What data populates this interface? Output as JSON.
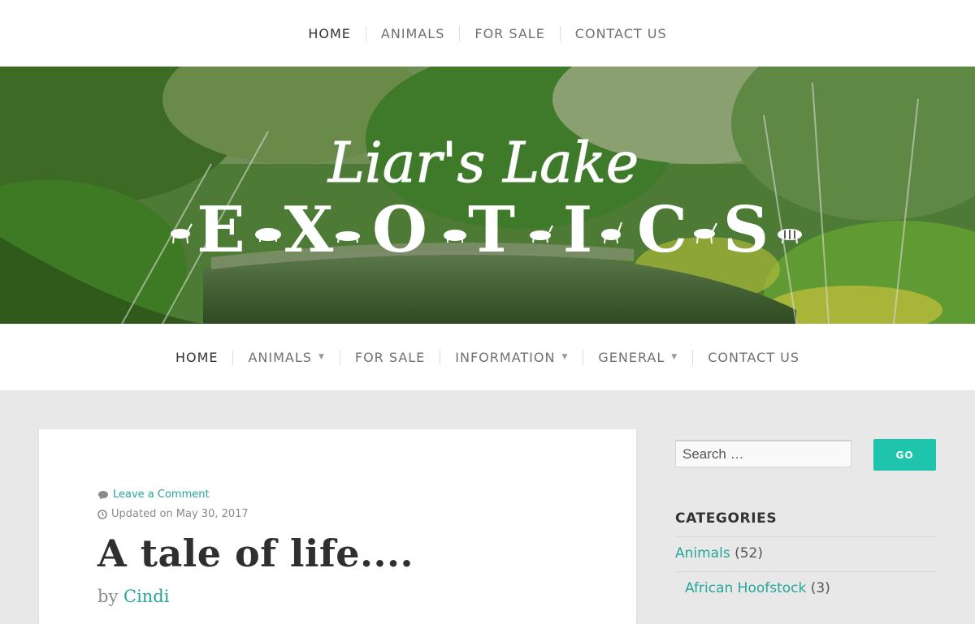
{
  "top_nav": {
    "items": [
      {
        "label": "HOME",
        "active": true
      },
      {
        "label": "ANIMALS"
      },
      {
        "label": "FOR SALE"
      },
      {
        "label": "CONTACT US"
      }
    ]
  },
  "header": {
    "logo_script": "Liar's Lake",
    "logo_letters": [
      "E",
      "X",
      "O",
      "T",
      "I",
      "C",
      "S"
    ]
  },
  "main_nav": {
    "items": [
      {
        "label": "HOME",
        "active": true
      },
      {
        "label": "ANIMALS",
        "has_dropdown": true
      },
      {
        "label": "FOR SALE"
      },
      {
        "label": "INFORMATION",
        "has_dropdown": true
      },
      {
        "label": "GENERAL",
        "has_dropdown": true
      },
      {
        "label": "CONTACT US"
      }
    ]
  },
  "post": {
    "comment_icon": "comment-icon",
    "comment_link": "Leave a Comment",
    "clock_icon": "clock-icon",
    "updated_text": "Updated on May 30, 2017",
    "title": "A tale of life....",
    "by_prefix": "by",
    "author": "Cindi"
  },
  "sidebar": {
    "search_placeholder": "Search …",
    "search_button": "GO",
    "categories_heading": "CATEGORIES",
    "categories": [
      {
        "name": "Animals",
        "count": "(52)",
        "level": 0
      },
      {
        "name": "African Hoofstock",
        "count": "(3)",
        "level": 1
      }
    ]
  },
  "colors": {
    "accent": "#26a69a",
    "button": "#1fc4ac",
    "page_bg": "#e8e8e8"
  }
}
